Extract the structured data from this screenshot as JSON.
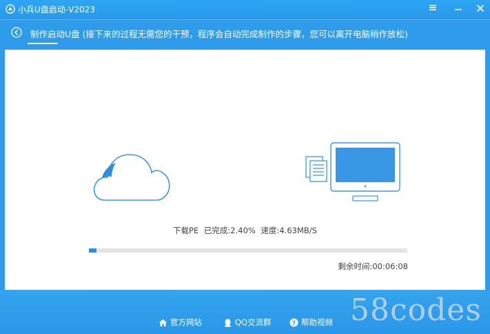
{
  "window": {
    "title": "小兵U盘启动-V2023",
    "menu_icon": "menu-icon",
    "minimize_icon": "minimize-icon",
    "close_icon": "close-icon"
  },
  "step": {
    "text": "制作启动U盘 (接下来的过程无需您的干预，程序会自动完成制作的步骤，您可以离开电脑稍作放松)",
    "icon": "back-arrow-icon"
  },
  "progress": {
    "task": "下载PE",
    "completed": "已完成:2.40%",
    "speed": "速度:4.63MB/S",
    "percent": 2.4,
    "remaining": "剩余时间:00:06:08"
  },
  "footer": {
    "official_site": "官方网站",
    "qq_group": "QQ交流群",
    "help_video": "帮助视频"
  },
  "watermark": "58codes",
  "colors": {
    "accent": "#2f9bea",
    "progress_fill": "#2b8fe0",
    "icon_blue": "#3a97e6"
  }
}
